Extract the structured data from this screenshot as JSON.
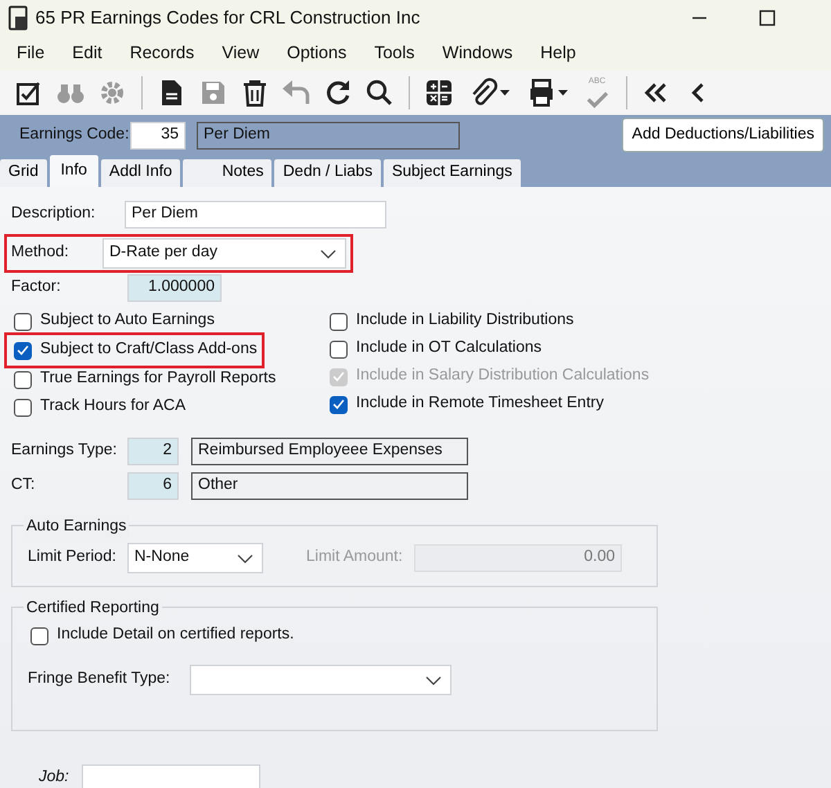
{
  "window": {
    "title": "65 PR Earnings Codes for CRL Construction Inc"
  },
  "menu": [
    "File",
    "Edit",
    "Records",
    "View",
    "Options",
    "Tools",
    "Windows",
    "Help"
  ],
  "toolbar": [
    {
      "kind": "edit",
      "disabled": false
    },
    {
      "kind": "binoculars",
      "disabled": true
    },
    {
      "kind": "gear",
      "disabled": true
    },
    {
      "kind": "sep"
    },
    {
      "kind": "document",
      "disabled": false
    },
    {
      "kind": "save",
      "disabled": true
    },
    {
      "kind": "trash",
      "disabled": false
    },
    {
      "kind": "undo",
      "disabled": true
    },
    {
      "kind": "refresh",
      "disabled": false
    },
    {
      "kind": "search",
      "disabled": false
    },
    {
      "kind": "sep"
    },
    {
      "kind": "calculator",
      "disabled": false
    },
    {
      "kind": "paperclip",
      "disabled": false,
      "dropdown": true
    },
    {
      "kind": "printer",
      "disabled": false,
      "dropdown": true
    },
    {
      "kind": "spellcheck",
      "disabled": true,
      "label": "ABC"
    },
    {
      "kind": "sep"
    },
    {
      "kind": "first",
      "disabled": false
    },
    {
      "kind": "previous",
      "disabled": false
    }
  ],
  "header": {
    "code_label": "Earnings Code:",
    "code": "35",
    "code_description": "Per Diem",
    "button": "Add Deductions/Liabilities"
  },
  "tabs": [
    {
      "label": "Grid",
      "selected": false
    },
    {
      "label": "Info",
      "selected": true
    },
    {
      "label": "Addl Info",
      "selected": false
    },
    {
      "label": "Notes",
      "selected": false
    },
    {
      "label": "Dedn / Liabs",
      "selected": false
    },
    {
      "label": "Subject Earnings",
      "selected": false
    }
  ],
  "description": {
    "label": "Description:",
    "value": "Per Diem"
  },
  "method": {
    "label": "Method:",
    "value": "D-Rate per day",
    "highlighted": true
  },
  "factor": {
    "label": "Factor:",
    "value": "1.000000"
  },
  "checkboxes_left": [
    {
      "label": "Subject to Auto Earnings",
      "checked": false,
      "disabled": false,
      "highlighted": false
    },
    {
      "label": "Subject to Craft/Class Add-ons",
      "checked": true,
      "disabled": false,
      "highlighted": true
    },
    {
      "label": "True Earnings for Payroll Reports",
      "checked": false,
      "disabled": false,
      "highlighted": false
    },
    {
      "label": "Track Hours for ACA",
      "checked": false,
      "disabled": false,
      "highlighted": false
    }
  ],
  "checkboxes_right": [
    {
      "label": "Include in Liability Distributions",
      "checked": false,
      "disabled": false
    },
    {
      "label": "Include in OT Calculations",
      "checked": false,
      "disabled": false
    },
    {
      "label": "Include in Salary Distribution Calculations",
      "checked": true,
      "disabled": true
    },
    {
      "label": "Include in Remote Timesheet Entry",
      "checked": true,
      "disabled": false
    }
  ],
  "earnings_type": {
    "label": "Earnings Type:",
    "code": "2",
    "description": "Reimbursed Employeee Expenses"
  },
  "ct": {
    "label": "CT:",
    "code": "6",
    "description": "Other"
  },
  "auto_earnings": {
    "title": "Auto Earnings",
    "limit_period_label": "Limit Period:",
    "limit_period": "N-None",
    "limit_amount_label": "Limit Amount:",
    "limit_amount": "0.00",
    "limit_amount_disabled": true
  },
  "certified_reporting": {
    "title": "Certified Reporting",
    "include_detail": {
      "label": "Include Detail on certified reports.",
      "checked": false
    },
    "fringe_label": "Fringe Benefit Type:"
  },
  "job": {
    "label": "Job:"
  }
}
